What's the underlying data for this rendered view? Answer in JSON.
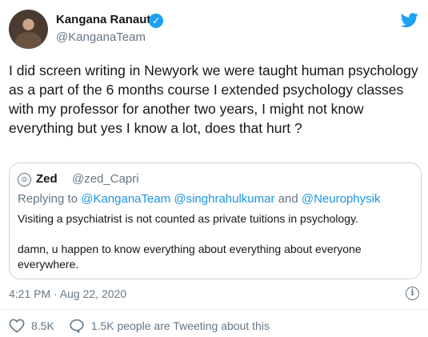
{
  "author": {
    "display_name": "Kangana Ranaut",
    "handle": "@KanganaTeam",
    "verified_icon": "verified-badge-icon"
  },
  "tweet": {
    "text": "I did screen writing in Newyork we were taught human psychology as a part of the 6 months course I extended psychology classes with my professor for another two years, I might not know everything but yes I know a lot, does that hurt ?",
    "timestamp": "4:21 PM · Aug 22, 2020"
  },
  "quoted_tweet": {
    "display_name": "Zed",
    "handle": "@zed_Capri",
    "replying_prefix": "Replying to",
    "mentions": [
      "@KanganaTeam",
      "@singhrahulkumar",
      "@Neurophysik"
    ],
    "replying_and": "and",
    "text": "Visiting a psychiatrist is not counted as private tuitions in psychology.\n\ndamn, u happen to know everything about everything about everyone everywhere."
  },
  "actions": {
    "likes": "8.5K",
    "talking": "1.5K people are Tweeting about this"
  },
  "colors": {
    "twitter_blue": "#1da1f2",
    "secondary_text": "#657786",
    "mention": "#1b95e0"
  }
}
